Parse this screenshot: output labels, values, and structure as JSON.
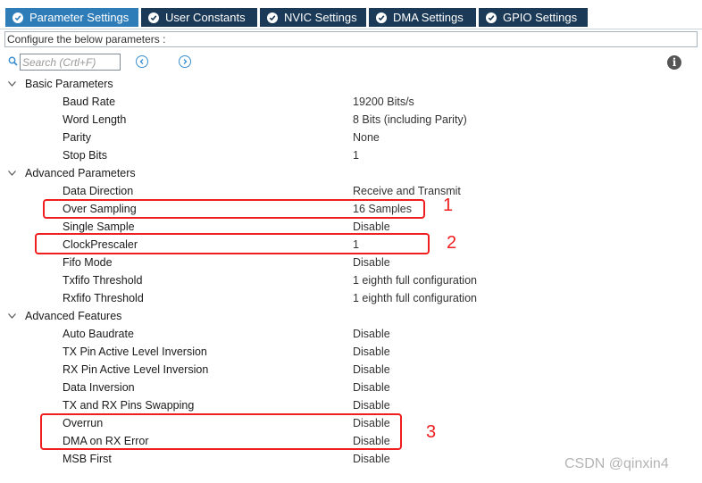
{
  "tabs": [
    {
      "label": "Parameter Settings",
      "active": true
    },
    {
      "label": "User Constants",
      "active": false
    },
    {
      "label": "NVIC Settings",
      "active": false
    },
    {
      "label": "DMA Settings",
      "active": false
    },
    {
      "label": "GPIO Settings",
      "active": false
    }
  ],
  "configure_label": "Configure the below parameters :",
  "search": {
    "placeholder": "Search (Crtl+F)"
  },
  "info_glyph": "i",
  "groups": [
    {
      "title": "Basic Parameters",
      "params": [
        {
          "name": "Baud Rate",
          "value": "19200 Bits/s"
        },
        {
          "name": "Word Length",
          "value": "8 Bits (including Parity)"
        },
        {
          "name": "Parity",
          "value": "None"
        },
        {
          "name": "Stop Bits",
          "value": "1"
        }
      ]
    },
    {
      "title": "Advanced Parameters",
      "params": [
        {
          "name": "Data Direction",
          "value": "Receive and Transmit"
        },
        {
          "name": "Over Sampling",
          "value": "16 Samples"
        },
        {
          "name": "Single Sample",
          "value": "Disable"
        },
        {
          "name": "ClockPrescaler",
          "value": "1"
        },
        {
          "name": "Fifo Mode",
          "value": "Disable"
        },
        {
          "name": "Txfifo Threshold",
          "value": "1 eighth full configuration"
        },
        {
          "name": "Rxfifo Threshold",
          "value": "1 eighth full configuration"
        }
      ]
    },
    {
      "title": "Advanced Features",
      "params": [
        {
          "name": "Auto Baudrate",
          "value": "Disable"
        },
        {
          "name": "TX Pin Active Level Inversion",
          "value": "Disable"
        },
        {
          "name": "RX Pin Active Level Inversion",
          "value": "Disable"
        },
        {
          "name": "Data Inversion",
          "value": "Disable"
        },
        {
          "name": "TX and RX Pins Swapping",
          "value": "Disable"
        },
        {
          "name": "Overrun",
          "value": "Disable"
        },
        {
          "name": "DMA on RX Error",
          "value": "Disable"
        },
        {
          "name": "MSB First",
          "value": "Disable"
        }
      ]
    }
  ],
  "annotations": {
    "one": "1",
    "two": "2",
    "three": "3",
    "color": "#f01e1e"
  },
  "watermark": "CSDN @qinxin4",
  "colors": {
    "tab_active": "#2e7cb8",
    "tab_inactive": "#1b3a57",
    "nav_accent": "#3a8fd0"
  }
}
